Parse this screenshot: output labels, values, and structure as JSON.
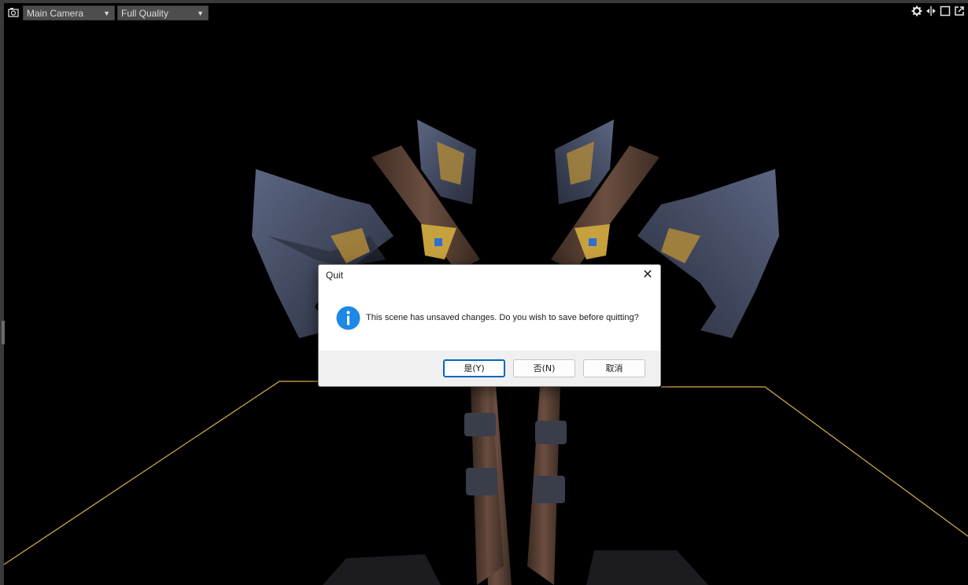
{
  "toolbar": {
    "camera_icon": "camera-icon",
    "camera_select": "Main Camera",
    "quality_select": "Full Quality",
    "right_icons": [
      "gear-icon",
      "pan-arrows-icon",
      "maximize-icon",
      "popout-icon"
    ]
  },
  "dialog": {
    "title": "Quit",
    "close_glyph": "✕",
    "icon": "info-icon",
    "message": "This scene has unsaved changes. Do you wish to save before quitting?",
    "buttons": {
      "yes": "是(Y)",
      "no": "否(N)",
      "cancel": "取消"
    }
  },
  "colors": {
    "floor_outline": "#d8b04a",
    "dropdown_bg": "#4d4d4d",
    "dialog_accent": "#0067c0",
    "info_icon": "#1e88e5"
  }
}
